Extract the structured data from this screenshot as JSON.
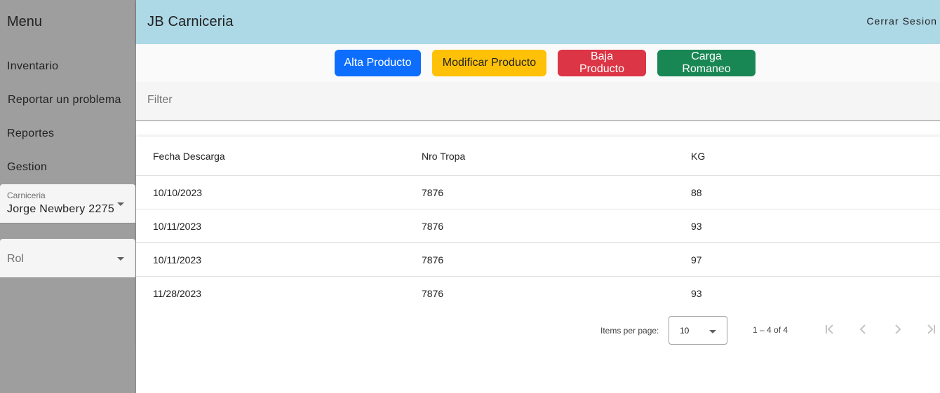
{
  "sidebar": {
    "title": "Menu",
    "items": [
      {
        "label": "Inventario"
      },
      {
        "label": "Reportar un problema"
      },
      {
        "label": "Reportes"
      },
      {
        "label": "Gestion"
      }
    ],
    "carniceria": {
      "label": "Carniceria",
      "value": "Jorge Newbery 2275"
    },
    "rol": {
      "placeholder": "Rol"
    }
  },
  "header": {
    "title": "JB Carniceria",
    "logout_label": "Cerrar Sesion",
    "color": "#add8e6"
  },
  "actions": {
    "alta": {
      "label": "Alta Producto",
      "color": "#0d6efd"
    },
    "modificar": {
      "label": "Modificar Producto",
      "color": "#ffc107"
    },
    "baja": {
      "label": "Baja Producto",
      "color": "#dc3545"
    },
    "carga": {
      "label": "Carga Romaneo",
      "color": "#198754"
    }
  },
  "filter": {
    "placeholder": "Filter",
    "value": ""
  },
  "table": {
    "columns": [
      "Fecha Descarga",
      "Nro Tropa",
      "KG"
    ],
    "rows": [
      [
        "10/10/2023",
        "7876",
        "88"
      ],
      [
        "10/11/2023",
        "7876",
        "93"
      ],
      [
        "10/11/2023",
        "7876",
        "97"
      ],
      [
        "11/28/2023",
        "7876",
        "93"
      ]
    ]
  },
  "paginator": {
    "items_per_page_label": "Items per page:",
    "items_per_page": "10",
    "range_label": "1 – 4 of 4",
    "icons": [
      "first-page-icon",
      "prev-page-icon",
      "next-page-icon",
      "last-page-icon"
    ]
  }
}
